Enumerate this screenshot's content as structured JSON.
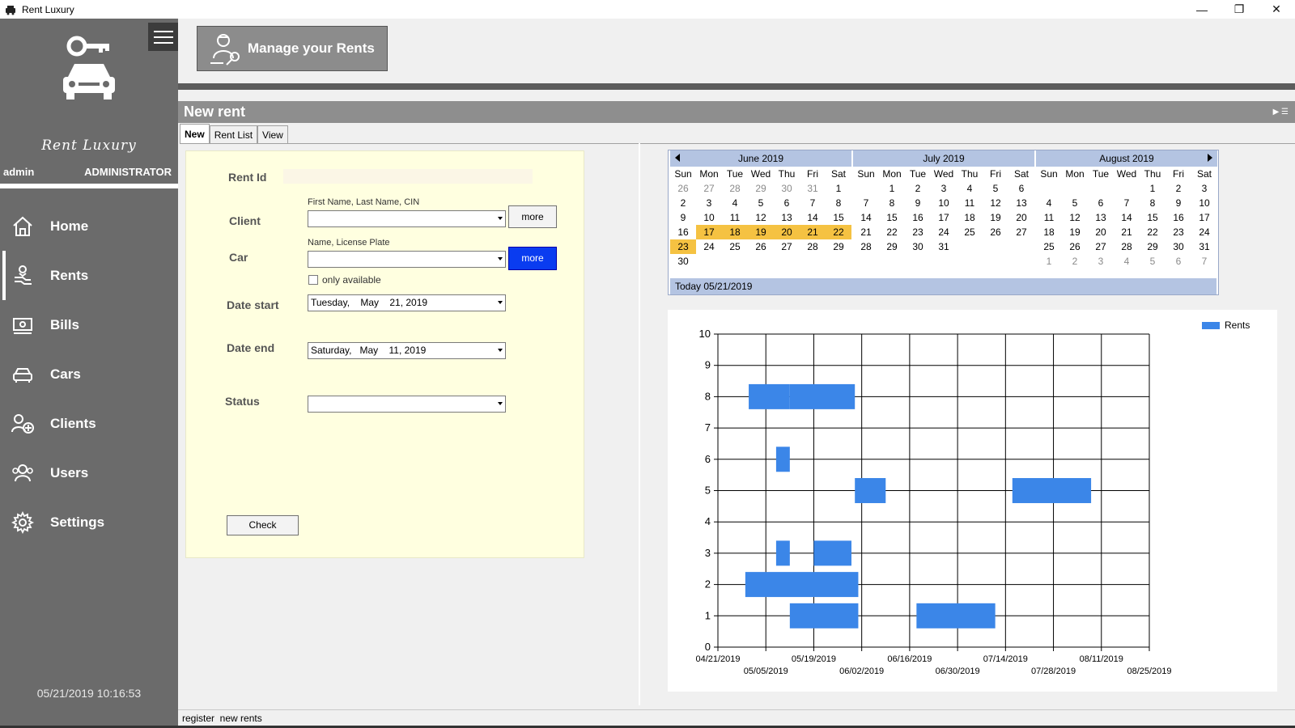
{
  "window": {
    "title": "Rent Luxury",
    "minimize": "—",
    "restore": "❐",
    "close": "✕"
  },
  "sidebar": {
    "brand": "Rent Luxury",
    "username": "admin",
    "role": "ADMINISTRATOR",
    "nav": [
      {
        "label": "Home",
        "icon": "home-icon"
      },
      {
        "label": "Rents",
        "icon": "rents-icon"
      },
      {
        "label": "Bills",
        "icon": "bills-icon"
      },
      {
        "label": "Cars",
        "icon": "car-icon"
      },
      {
        "label": "Clients",
        "icon": "clients-icon"
      },
      {
        "label": "Users",
        "icon": "users-icon"
      },
      {
        "label": "Settings",
        "icon": "gear-icon"
      }
    ],
    "active_nav": "Rents",
    "clock": "05/21/2019 10:16:53"
  },
  "header": {
    "manage_label": "Manage your Rents"
  },
  "panel": {
    "title": "New rent",
    "tabs": [
      "New",
      "Rent List",
      "View"
    ],
    "active_tab": "New"
  },
  "form": {
    "rent_id_label": "Rent Id",
    "rent_id_value": "",
    "client_label": "Client",
    "client_hint": "First Name, Last Name, CIN",
    "client_value": "",
    "client_more": "more",
    "car_label": "Car",
    "car_hint": "Name, License Plate",
    "car_value": "",
    "car_more": "more",
    "only_available_label": "only available",
    "only_available_checked": false,
    "date_start_label": "Date start",
    "date_start_value": "Tuesday,    May    21, 2019",
    "date_end_label": "Date end",
    "date_end_value": "Saturday,   May    11, 2019",
    "status_label": "Status",
    "status_value": "",
    "check_button": "Check"
  },
  "calendar": {
    "dows": [
      "Sun",
      "Mon",
      "Tue",
      "Wed",
      "Thu",
      "Fri",
      "Sat"
    ],
    "months": [
      {
        "name": "June 2019",
        "days": [
          [
            "26",
            "27",
            "28",
            "29",
            "30",
            "31",
            "1"
          ],
          [
            "2",
            "3",
            "4",
            "5",
            "6",
            "7",
            "8"
          ],
          [
            "9",
            "10",
            "11",
            "12",
            "13",
            "14",
            "15"
          ],
          [
            "16",
            "17",
            "18",
            "19",
            "20",
            "21",
            "22"
          ],
          [
            "23",
            "24",
            "25",
            "26",
            "27",
            "28",
            "29"
          ],
          [
            "30",
            "",
            "",
            "",
            "",
            "",
            ""
          ]
        ],
        "other": [
          [
            0,
            0
          ],
          [
            0,
            1
          ],
          [
            0,
            2
          ],
          [
            0,
            3
          ],
          [
            0,
            4
          ],
          [
            0,
            5
          ]
        ],
        "highlight": [
          [
            3,
            1
          ],
          [
            3,
            2
          ],
          [
            3,
            3
          ],
          [
            3,
            4
          ],
          [
            3,
            5
          ],
          [
            3,
            6
          ],
          [
            4,
            0
          ]
        ]
      },
      {
        "name": "July 2019",
        "days": [
          [
            "",
            "1",
            "2",
            "3",
            "4",
            "5",
            "6"
          ],
          [
            "7",
            "8",
            "9",
            "10",
            "11",
            "12",
            "13"
          ],
          [
            "14",
            "15",
            "16",
            "17",
            "18",
            "19",
            "20"
          ],
          [
            "21",
            "22",
            "23",
            "24",
            "25",
            "26",
            "27"
          ],
          [
            "28",
            "29",
            "30",
            "31",
            "",
            "",
            ""
          ],
          [
            "",
            "",
            "",
            "",
            "",
            "",
            ""
          ]
        ],
        "other": [],
        "highlight": []
      },
      {
        "name": "August 2019",
        "days": [
          [
            "",
            "",
            "",
            "",
            "1",
            "2",
            "3"
          ],
          [
            "4",
            "5",
            "6",
            "7",
            "8",
            "9",
            "10"
          ],
          [
            "11",
            "12",
            "13",
            "14",
            "15",
            "16",
            "17"
          ],
          [
            "18",
            "19",
            "20",
            "21",
            "22",
            "23",
            "24"
          ],
          [
            "25",
            "26",
            "27",
            "28",
            "29",
            "30",
            "31"
          ],
          [
            "1",
            "2",
            "3",
            "4",
            "5",
            "6",
            "7"
          ]
        ],
        "other": [
          [
            5,
            0
          ],
          [
            5,
            1
          ],
          [
            5,
            2
          ],
          [
            5,
            3
          ],
          [
            5,
            4
          ],
          [
            5,
            5
          ],
          [
            5,
            6
          ]
        ],
        "highlight": []
      }
    ],
    "today_label": "Today 05/21/2019"
  },
  "chart_data": {
    "type": "range-bar",
    "legend": [
      "Rents"
    ],
    "legend_position": "top-right",
    "color": "#3b86e8",
    "ylim": [
      0,
      10
    ],
    "yticks": [
      0,
      1,
      2,
      3,
      4,
      5,
      6,
      7,
      8,
      9,
      10
    ],
    "xlim": [
      "2019-04-21",
      "2019-08-25"
    ],
    "xticks": [
      "04/21/2019",
      "05/05/2019",
      "05/19/2019",
      "06/02/2019",
      "06/16/2019",
      "06/30/2019",
      "07/14/2019",
      "07/28/2019",
      "08/11/2019",
      "08/25/2019"
    ],
    "bars": [
      {
        "y": 8,
        "start": "2019-04-30",
        "end": "2019-05-12"
      },
      {
        "y": 8,
        "start": "2019-05-12",
        "end": "2019-05-31"
      },
      {
        "y": 6,
        "start": "2019-05-08",
        "end": "2019-05-12"
      },
      {
        "y": 5,
        "start": "2019-05-31",
        "end": "2019-06-09"
      },
      {
        "y": 5,
        "start": "2019-07-16",
        "end": "2019-08-08"
      },
      {
        "y": 3,
        "start": "2019-05-08",
        "end": "2019-05-12"
      },
      {
        "y": 3,
        "start": "2019-05-19",
        "end": "2019-05-30"
      },
      {
        "y": 2,
        "start": "2019-04-29",
        "end": "2019-06-01"
      },
      {
        "y": 1,
        "start": "2019-05-12",
        "end": "2019-06-01"
      },
      {
        "y": 1,
        "start": "2019-06-18",
        "end": "2019-07-11"
      }
    ]
  },
  "statusbar": {
    "text": "register  new rents"
  }
}
